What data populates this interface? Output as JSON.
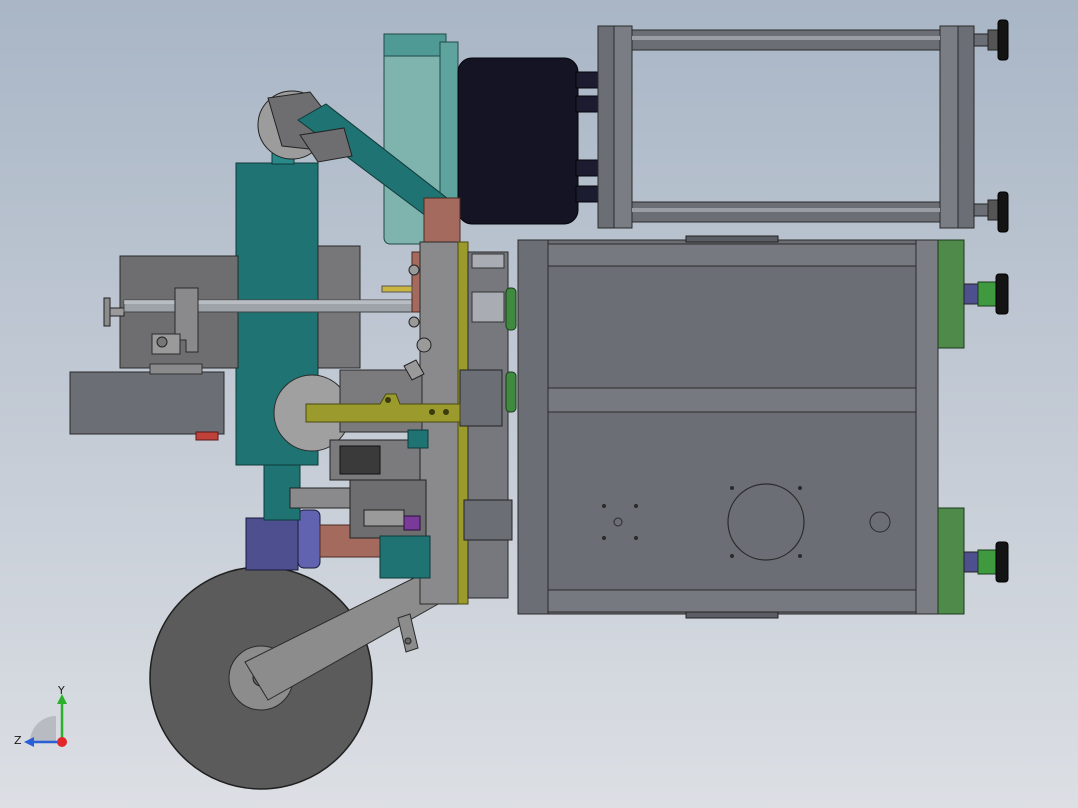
{
  "viewport": {
    "background_top": "#a9b6c6",
    "background_bottom": "#dcdfe4"
  },
  "colors": {
    "frame_gray": "#6b6e75",
    "frame_dark": "#4a4d54",
    "plate_gray": "#8a8a8c",
    "teal": "#1f7373",
    "teal_light": "#7fb3ad",
    "motor_black": "#141424",
    "arm_olive": "#9b9a2c",
    "copper": "#a56a5e",
    "roller_dark": "#5a5a5a",
    "green_block": "#4f8a4a",
    "purple_block": "#4e4f8e",
    "axis_x": "#e2262a",
    "axis_y": "#2bb02b",
    "axis_z": "#2b5fd6"
  },
  "triad": {
    "y_label": "Y",
    "z_label": "Z",
    "icon": "coordinate-triad-icon"
  }
}
